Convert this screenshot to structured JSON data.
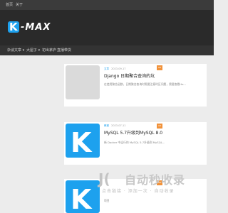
{
  "topbar": {
    "home": "首页",
    "about": "关于"
  },
  "header": {
    "logo_letter": "K",
    "logo_text": "-MAX"
  },
  "nav": {
    "items": [
      "杂谈文章 ▾",
      "大屋子 ▾",
      "初出茅庐",
      "直播带货"
    ]
  },
  "posts": [
    {
      "tag": "文章",
      "date": "2023-09-17",
      "badge": "AD",
      "title": "Django 日期聚合查询的坑",
      "excerpt": "在使用聚合函数，日期聚合查询时需要注意时区问题，需要查看Ho..."
    },
    {
      "tag": "教程",
      "date": "2023-07-11",
      "badge": "AD",
      "title": "MySQL 5.7升级到MySQL 8.0",
      "excerpt": "新 Docker 中运行的 MySQL 5.7升级到 MySQL..."
    },
    {
      "tag": "",
      "date": "",
      "badge": "AD",
      "title": "",
      "excerpt": "项目"
    }
  ],
  "watermark": {
    "title": "自动秒收录",
    "subtitle": "点击链接 · 添加一次 · 自动收录"
  }
}
